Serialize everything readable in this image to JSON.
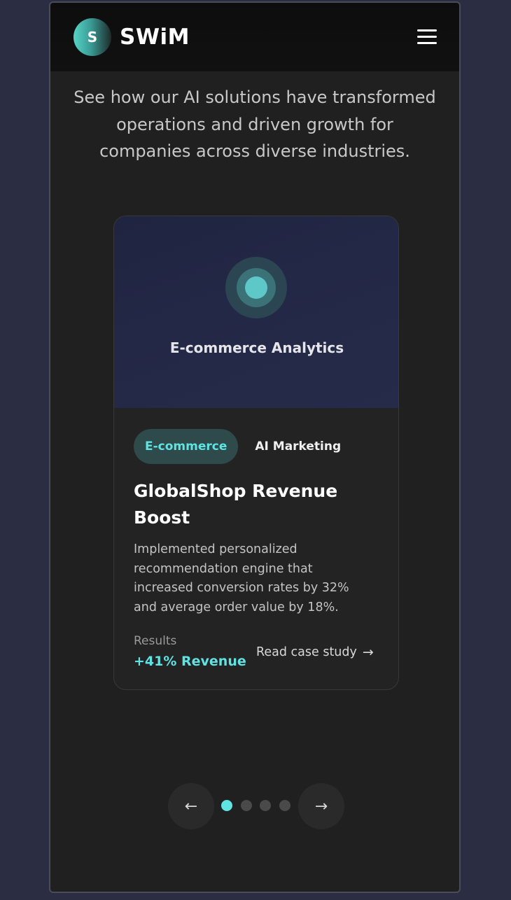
{
  "header": {
    "logo_letter": "S",
    "brand": "SWiM",
    "menu_icon": "hamburger-menu-icon"
  },
  "intro": {
    "text": "See how our AI solutions have transformed operations and driven growth for companies across diverse industries."
  },
  "case_study": {
    "media_caption": "E-commerce Analytics",
    "tags": [
      "E-commerce",
      "AI Marketing"
    ],
    "title": "GlobalShop Revenue Boost",
    "description": "Implemented personalized recommendation engine that increased conversion rates by 32% and average order value by 18%.",
    "results_label": "Results",
    "results_value": "+41% Revenue",
    "link_label": "Read case study",
    "link_icon": "arrow-right-icon"
  },
  "carousel": {
    "prev_icon": "arrow-left-icon",
    "next_icon": "arrow-right-icon",
    "prev_glyph": "←",
    "next_glyph": "→",
    "link_glyph": "→",
    "active_index": 0,
    "slide_count": 4
  },
  "colors": {
    "accent": "#5fe3e3",
    "background": "#202020",
    "card": "#232323",
    "page_backdrop": "#2b2e42"
  }
}
